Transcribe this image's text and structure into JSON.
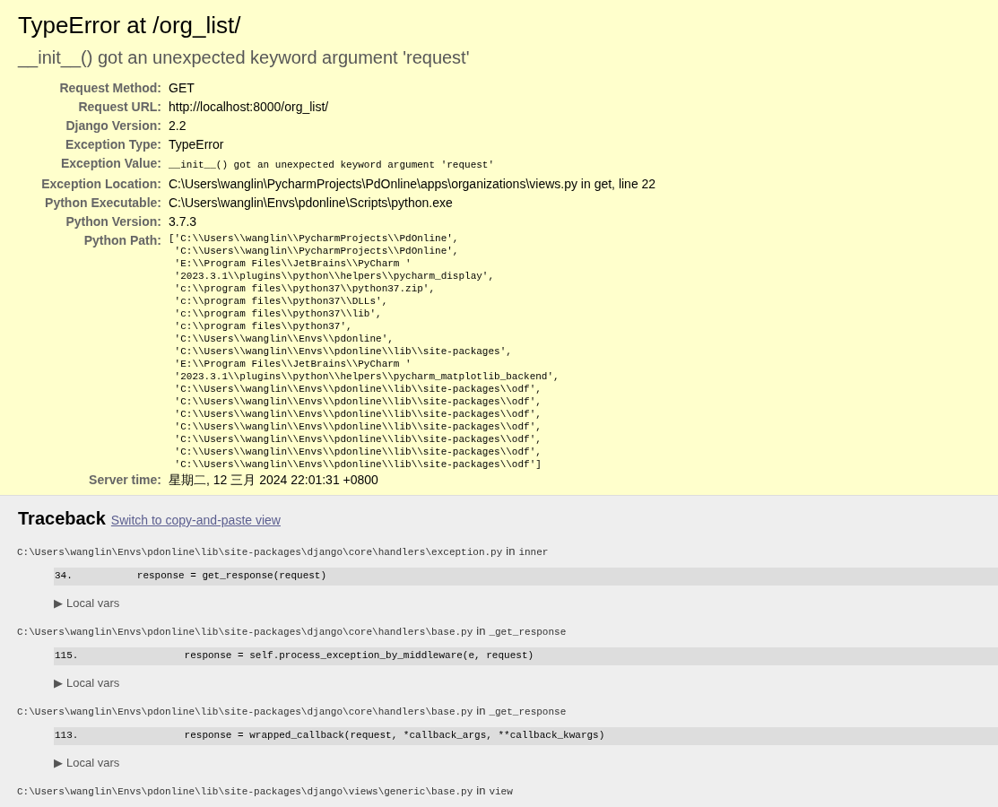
{
  "title": "TypeError at /org_list/",
  "subtitle": "__init__() got an unexpected keyword argument 'request'",
  "meta": [
    {
      "label": "Request Method:",
      "value": "GET",
      "kind": "text"
    },
    {
      "label": "Request URL:",
      "value": "http://localhost:8000/org_list/",
      "kind": "text"
    },
    {
      "label": "Django Version:",
      "value": "2.2",
      "kind": "text"
    },
    {
      "label": "Exception Type:",
      "value": "TypeError",
      "kind": "text"
    },
    {
      "label": "Exception Value:",
      "value": "__init__() got an unexpected keyword argument 'request'",
      "kind": "code"
    },
    {
      "label": "Exception Location:",
      "value": "C:\\Users\\wanglin\\PycharmProjects\\PdOnline\\apps\\organizations\\views.py in get, line 22",
      "kind": "text"
    },
    {
      "label": "Python Executable:",
      "value": "C:\\Users\\wanglin\\Envs\\pdonline\\Scripts\\python.exe",
      "kind": "text"
    },
    {
      "label": "Python Version:",
      "value": "3.7.3",
      "kind": "text"
    },
    {
      "label": "Python Path:",
      "kind": "lines",
      "lines": [
        "['C:\\\\Users\\\\wanglin\\\\PycharmProjects\\\\PdOnline',",
        " 'C:\\\\Users\\\\wanglin\\\\PycharmProjects\\\\PdOnline',",
        " 'E:\\\\Program Files\\\\JetBrains\\\\PyCharm '",
        " '2023.3.1\\\\plugins\\\\python\\\\helpers\\\\pycharm_display',",
        " 'c:\\\\program files\\\\python37\\\\python37.zip',",
        " 'c:\\\\program files\\\\python37\\\\DLLs',",
        " 'c:\\\\program files\\\\python37\\\\lib',",
        " 'c:\\\\program files\\\\python37',",
        " 'C:\\\\Users\\\\wanglin\\\\Envs\\\\pdonline',",
        " 'C:\\\\Users\\\\wanglin\\\\Envs\\\\pdonline\\\\lib\\\\site-packages',",
        " 'E:\\\\Program Files\\\\JetBrains\\\\PyCharm '",
        " '2023.3.1\\\\plugins\\\\python\\\\helpers\\\\pycharm_matplotlib_backend',",
        " 'C:\\\\Users\\\\wanglin\\\\Envs\\\\pdonline\\\\lib\\\\site-packages\\\\odf',",
        " 'C:\\\\Users\\\\wanglin\\\\Envs\\\\pdonline\\\\lib\\\\site-packages\\\\odf',",
        " 'C:\\\\Users\\\\wanglin\\\\Envs\\\\pdonline\\\\lib\\\\site-packages\\\\odf',",
        " 'C:\\\\Users\\\\wanglin\\\\Envs\\\\pdonline\\\\lib\\\\site-packages\\\\odf',",
        " 'C:\\\\Users\\\\wanglin\\\\Envs\\\\pdonline\\\\lib\\\\site-packages\\\\odf',",
        " 'C:\\\\Users\\\\wanglin\\\\Envs\\\\pdonline\\\\lib\\\\site-packages\\\\odf',",
        " 'C:\\\\Users\\\\wanglin\\\\Envs\\\\pdonline\\\\lib\\\\site-packages\\\\odf']"
      ]
    },
    {
      "label": "Server time:",
      "value": "星期二, 12 三月 2024 22:01:31 +0800",
      "kind": "text"
    }
  ],
  "traceback": {
    "heading": "Traceback",
    "link": "Switch to copy-and-paste view",
    "frames": [
      {
        "file": "C:\\Users\\wanglin\\Envs\\pdonline\\lib\\site-packages\\django\\core\\handlers\\exception.py",
        "in": "in",
        "function": "inner",
        "line_number": "34.",
        "code": "        response = get_response(request)",
        "toggle": "▶",
        "vars_label": "Local vars"
      },
      {
        "file": "C:\\Users\\wanglin\\Envs\\pdonline\\lib\\site-packages\\django\\core\\handlers\\base.py",
        "in": "in",
        "function": "_get_response",
        "line_number": "115.",
        "code": "                response = self.process_exception_by_middleware(e, request)",
        "toggle": "▶",
        "vars_label": "Local vars"
      },
      {
        "file": "C:\\Users\\wanglin\\Envs\\pdonline\\lib\\site-packages\\django\\core\\handlers\\base.py",
        "in": "in",
        "function": "_get_response",
        "line_number": "113.",
        "code": "                response = wrapped_callback(request, *callback_args, **callback_kwargs)",
        "toggle": "▶",
        "vars_label": "Local vars"
      },
      {
        "file": "C:\\Users\\wanglin\\Envs\\pdonline\\lib\\site-packages\\django\\views\\generic\\base.py",
        "in": "in",
        "function": "view"
      }
    ]
  }
}
